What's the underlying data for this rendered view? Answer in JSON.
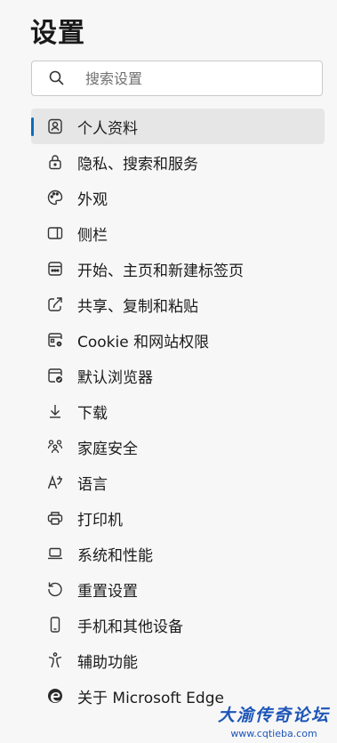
{
  "header": {
    "title": "设置"
  },
  "search": {
    "placeholder": "搜索设置"
  },
  "nav": {
    "items": [
      {
        "label": "个人资料",
        "icon": "profile-icon",
        "active": true
      },
      {
        "label": "隐私、搜索和服务",
        "icon": "lock-icon"
      },
      {
        "label": "外观",
        "icon": "palette-icon"
      },
      {
        "label": "侧栏",
        "icon": "sidebar-icon"
      },
      {
        "label": "开始、主页和新建标签页",
        "icon": "start-page-icon"
      },
      {
        "label": "共享、复制和粘贴",
        "icon": "share-icon"
      },
      {
        "label": "Cookie 和网站权限",
        "icon": "site-permissions-icon"
      },
      {
        "label": "默认浏览器",
        "icon": "default-browser-icon"
      },
      {
        "label": "下载",
        "icon": "download-icon"
      },
      {
        "label": "家庭安全",
        "icon": "family-icon"
      },
      {
        "label": "语言",
        "icon": "language-icon"
      },
      {
        "label": "打印机",
        "icon": "printer-icon"
      },
      {
        "label": "系统和性能",
        "icon": "laptop-icon"
      },
      {
        "label": "重置设置",
        "icon": "reset-icon"
      },
      {
        "label": "手机和其他设备",
        "icon": "phone-icon"
      },
      {
        "label": "辅助功能",
        "icon": "accessibility-icon"
      },
      {
        "label": "关于 Microsoft Edge",
        "icon": "edge-logo-icon"
      }
    ]
  },
  "watermark": {
    "main": "大渝传奇论坛",
    "sub": "www.cqtieba.com"
  },
  "colors": {
    "accent": "#0f6cbd",
    "background": "#f7f7f7",
    "active_bg": "#e6e6e6"
  }
}
